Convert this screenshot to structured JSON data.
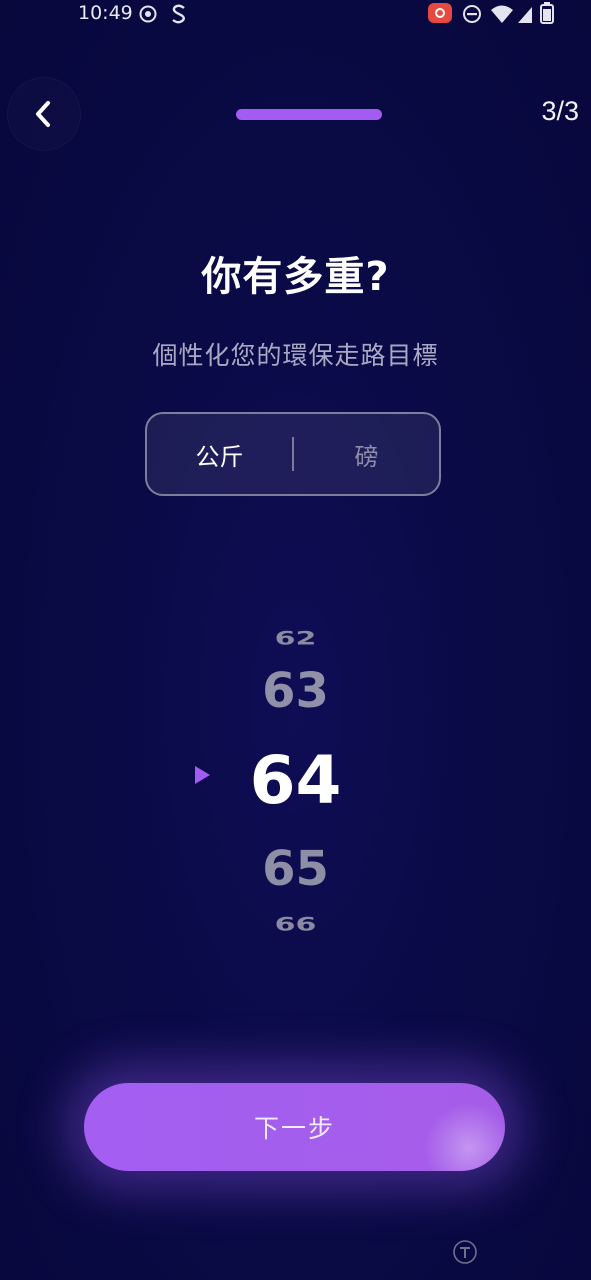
{
  "status_bar": {
    "time": "10:49",
    "icons": [
      "record-icon",
      "dnd-icon",
      "wifi-icon",
      "signal-icon",
      "battery-icon"
    ]
  },
  "header": {
    "back_icon": "chevron-left-icon",
    "progress_fraction": 1.0,
    "step_counter": "3/3"
  },
  "main": {
    "title": "你有多重?",
    "subtitle": "個性化您的環保走路目標",
    "unit_toggle": {
      "options": [
        {
          "label": "公斤",
          "selected": true
        },
        {
          "label": "磅",
          "selected": false
        }
      ]
    },
    "weight_picker": {
      "values": [
        "62",
        "63",
        "64",
        "65",
        "66"
      ],
      "selected": "64"
    }
  },
  "footer": {
    "next_label": "下一步"
  },
  "colors": {
    "background": "#0a0a46",
    "accent": "#a35cf2",
    "text_primary": "#ffffff",
    "text_secondary": "#a9a9c4"
  }
}
